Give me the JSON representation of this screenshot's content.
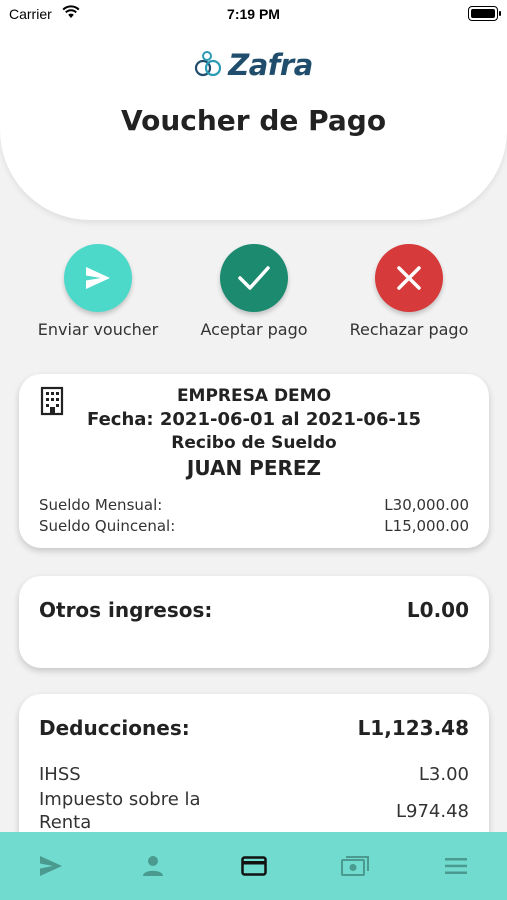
{
  "status_bar": {
    "carrier": "Carrier",
    "time": "7:19 PM"
  },
  "header": {
    "logo_text": "Zafra",
    "title": "Voucher de Pago"
  },
  "actions": [
    {
      "label": "Enviar voucher",
      "icon": "send-icon",
      "color": "#4dd9c9"
    },
    {
      "label": "Aceptar pago",
      "icon": "check-icon",
      "color": "#1b8a6f"
    },
    {
      "label": "Rechazar pago",
      "icon": "close-icon",
      "color": "#d63a3a"
    }
  ],
  "voucher": {
    "company": "EMPRESA DEMO",
    "date_range": "Fecha: 2021-06-01 al 2021-06-15",
    "receipt_label": "Recibo de Sueldo",
    "employee": "JUAN PEREZ",
    "monthly_label": "Sueldo Mensual:",
    "monthly_value": "L30,000.00",
    "biweekly_label": "Sueldo Quincenal:",
    "biweekly_value": "L15,000.00"
  },
  "other_income": {
    "label": "Otros ingresos:",
    "value": "L0.00"
  },
  "deductions": {
    "label": "Deducciones:",
    "total": "L1,123.48",
    "items": [
      {
        "name": "IHSS",
        "value": "L3.00"
      },
      {
        "name": "Impuesto sobre la Renta",
        "value": "L974.48"
      }
    ]
  },
  "bottom_nav": {
    "background": "#72dbcf",
    "items": [
      {
        "icon": "send-icon",
        "active": false
      },
      {
        "icon": "person-icon",
        "active": false
      },
      {
        "icon": "credit-card-icon",
        "active": true
      },
      {
        "icon": "cash-icon",
        "active": false
      },
      {
        "icon": "menu-icon",
        "active": false
      }
    ]
  }
}
